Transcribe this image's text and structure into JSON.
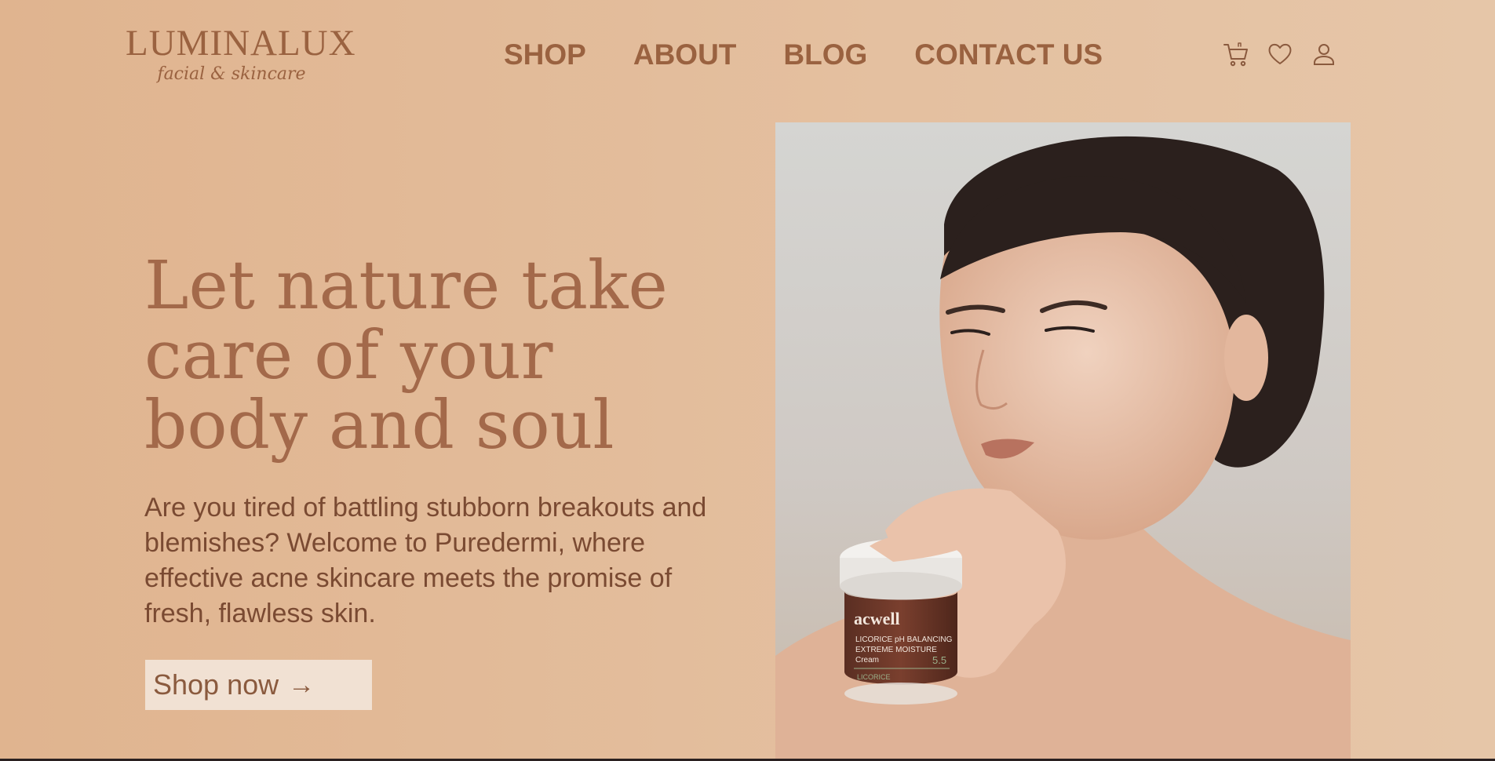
{
  "brand": {
    "name": "LUMINALUX",
    "tagline": "facial & skincare"
  },
  "nav": {
    "items": [
      {
        "label": "SHOP"
      },
      {
        "label": "ABOUT"
      },
      {
        "label": "BLOG"
      },
      {
        "label": "CONTACT US"
      }
    ]
  },
  "header_icons": [
    "cart-icon",
    "heart-icon",
    "user-icon"
  ],
  "hero": {
    "headline_lines": [
      "Let nature take",
      "care of your",
      "body and soul"
    ],
    "description": "Are you tired of battling stubborn breakouts and blemishes? Welcome to Puredermi, where effective acne skincare meets the promise of fresh, flawless skin.",
    "cta_label": "Shop now",
    "cta_icon": "arrow-right-icon",
    "image": {
      "subject": "woman holding skincare jar",
      "jar_brand": "acwell",
      "jar_lines": [
        "LICORICE pH BALANCING",
        "EXTREME MOISTURE",
        "Cream"
      ],
      "jar_ph": "5.5",
      "jar_band": "LICORICE"
    }
  },
  "colors": {
    "background": "#e0b48f",
    "accent": "#9a6240",
    "headline": "#a3694a",
    "button_bg": "#f1e1d3"
  }
}
